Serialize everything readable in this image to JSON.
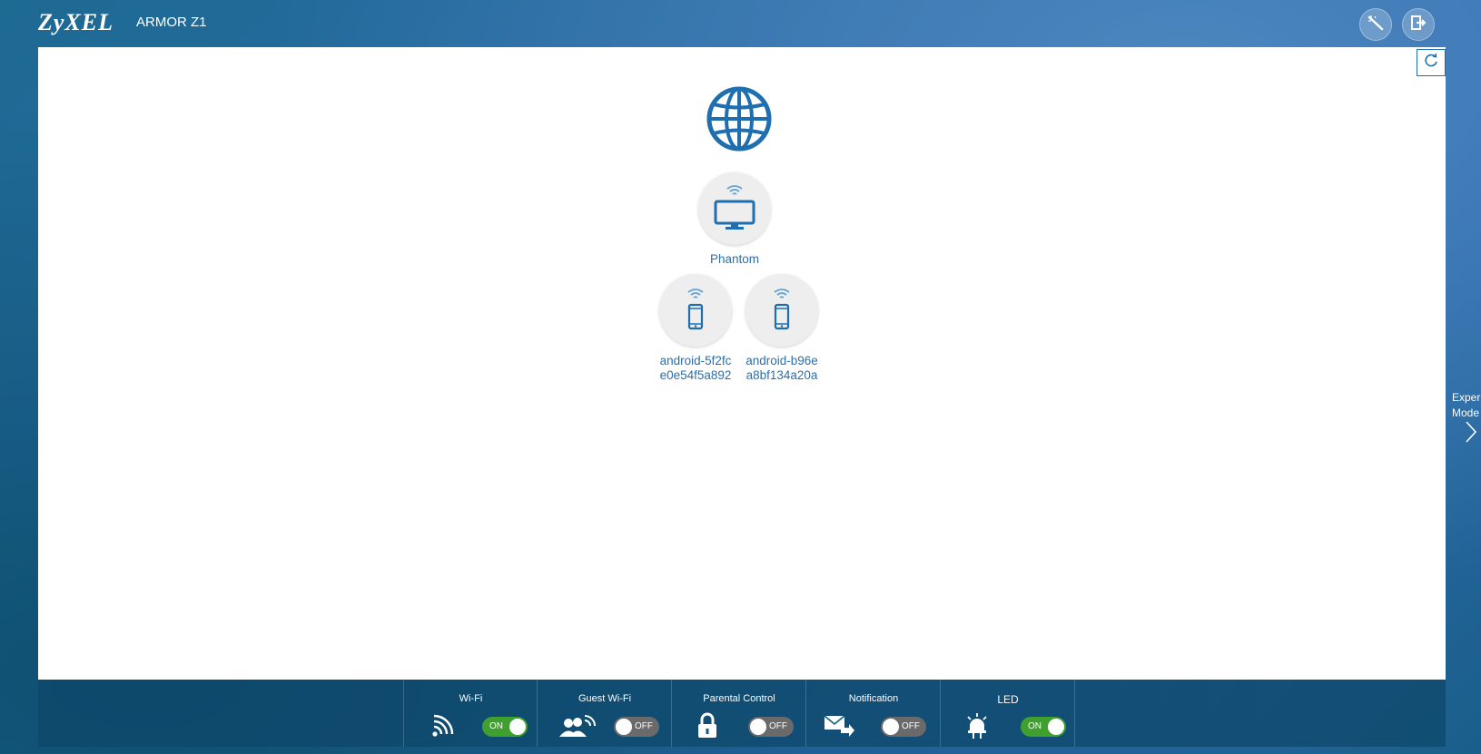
{
  "header": {
    "brand": "ZyXEL",
    "model": "ARMOR Z1",
    "wizard_icon": "magic-wand-icon",
    "logout_icon": "logout-icon"
  },
  "topology": {
    "internet_icon": "globe-icon",
    "router": {
      "name": "Phantom",
      "icon": "monitor-icon"
    },
    "clients": [
      {
        "name_line1": "android-5f2fc",
        "name_line2": "e0e54f5a892",
        "icon": "smartphone-icon"
      },
      {
        "name_line1": "android-b96e",
        "name_line2": "a8bf134a20a",
        "icon": "smartphone-icon"
      }
    ]
  },
  "side": {
    "expert_line1": "Exper",
    "expert_line2": "Mode"
  },
  "controls": [
    {
      "title": "Wi-Fi",
      "state": "ON",
      "icon": "wifi-signal-icon"
    },
    {
      "title": "Guest Wi-Fi",
      "state": "OFF",
      "icon": "guest-users-icon"
    },
    {
      "title": "Parental Control",
      "state": "OFF",
      "icon": "lock-icon"
    },
    {
      "title": "Notification",
      "state": "OFF",
      "icon": "mail-forward-icon"
    },
    {
      "title": "LED",
      "state": "ON",
      "icon": "led-light-icon"
    }
  ],
  "colors": {
    "accent": "#1f6fb0",
    "toggle_on": "#3fa02f",
    "toggle_off": "#6a6a6a"
  }
}
